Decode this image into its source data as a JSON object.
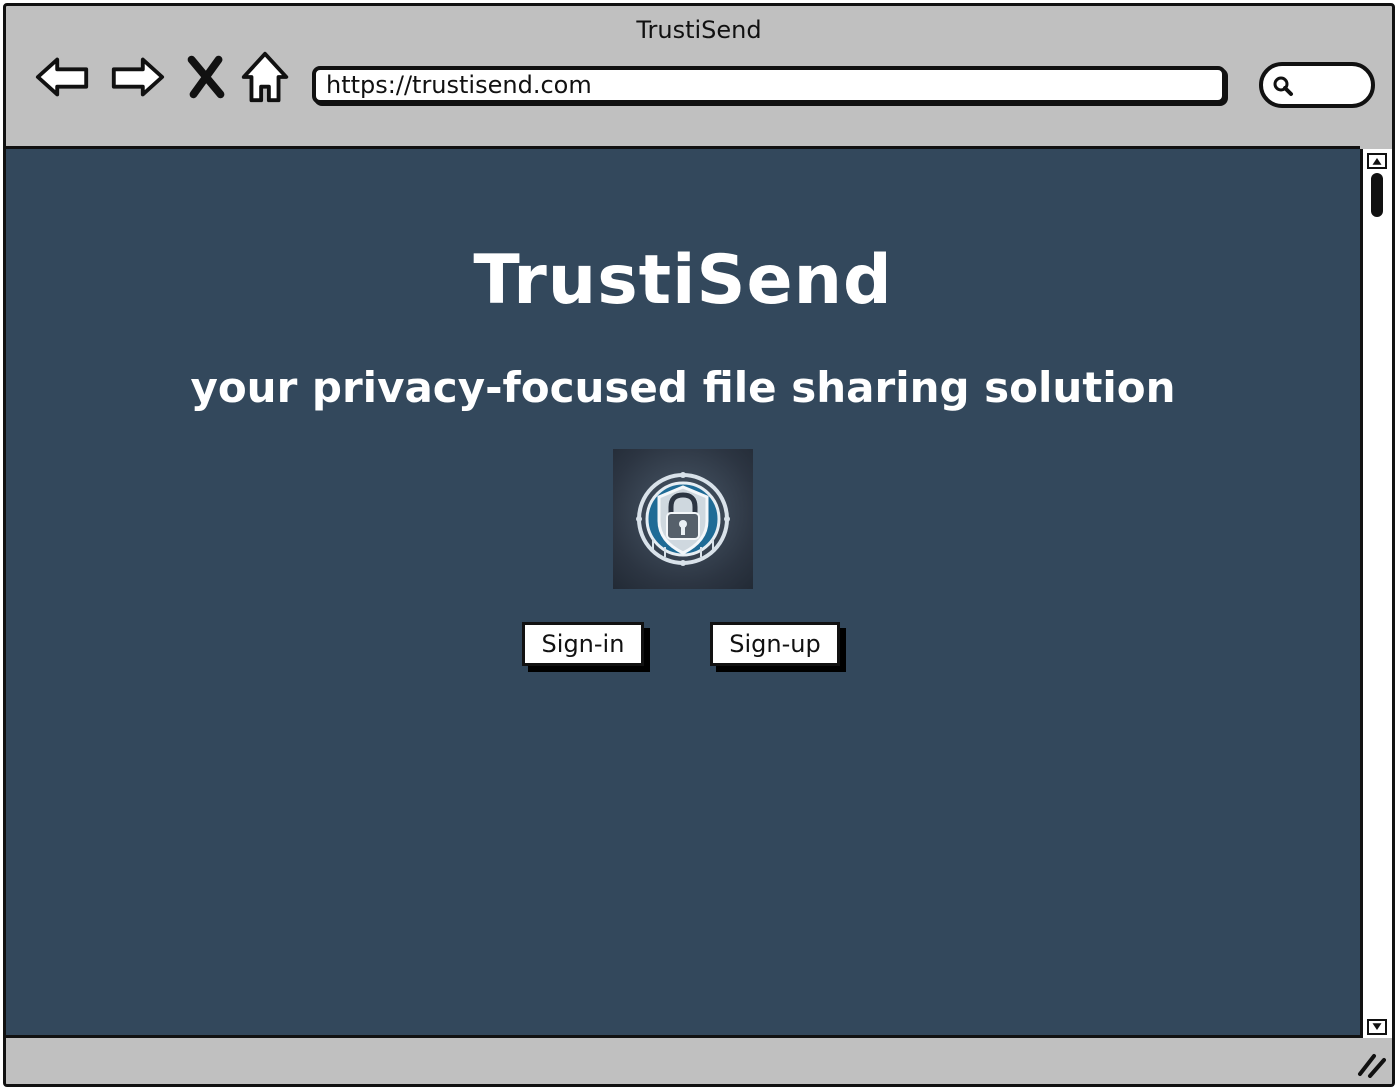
{
  "window": {
    "title": "TrustiSend"
  },
  "toolbar": {
    "back_icon": "arrow-left-icon",
    "forward_icon": "arrow-right-icon",
    "stop_icon": "close-icon",
    "home_icon": "home-icon",
    "url": "https://trustisend.com",
    "search_icon": "search-icon"
  },
  "page": {
    "heading": "TrustiSend",
    "tagline": "your privacy-focused file sharing solution",
    "logo_icon": "shield-lock-icon",
    "signin_label": "Sign-in",
    "signup_label": "Sign-up",
    "background_color": "#33485c"
  }
}
